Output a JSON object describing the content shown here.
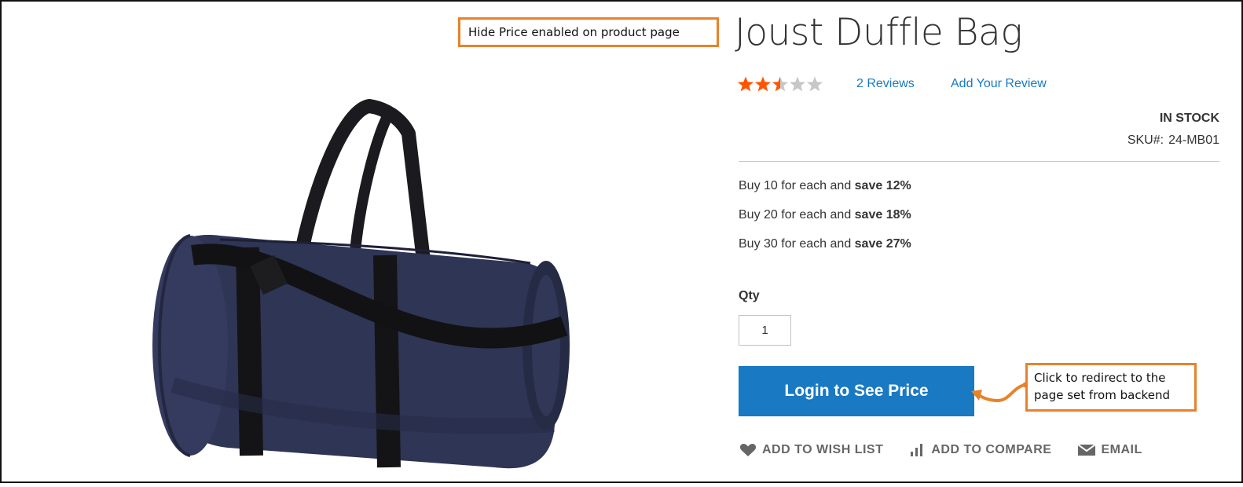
{
  "annotations": {
    "top": "Hide Price enabled on product page",
    "side_line1": "Click to redirect to the",
    "side_line2": "page set from backend",
    "accent_color": "#e8822a"
  },
  "product": {
    "name": "Joust Duffle Bag",
    "rating_fraction": 0.5,
    "stars_total": 5,
    "reviews_link": "2 Reviews",
    "add_review_link": "Add Your Review",
    "stock_status": "In stock",
    "sku_label": "SKU#:",
    "sku_value": "24-MB01"
  },
  "tier_prices": [
    {
      "prefix": "Buy 10 for each and ",
      "save": "save 12%"
    },
    {
      "prefix": "Buy 20 for each and ",
      "save": "save 18%"
    },
    {
      "prefix": "Buy 30 for each and ",
      "save": "save 27%"
    }
  ],
  "qty": {
    "label": "Qty",
    "value": "1"
  },
  "login_button": "Login to See Price",
  "actions": {
    "wishlist": "Add to Wish List",
    "compare": "Add to Compare",
    "email": "Email"
  },
  "colors": {
    "link": "#1979c3",
    "button": "#1979c3",
    "star": "#ff5501",
    "star_empty": "#c7c7c7"
  }
}
